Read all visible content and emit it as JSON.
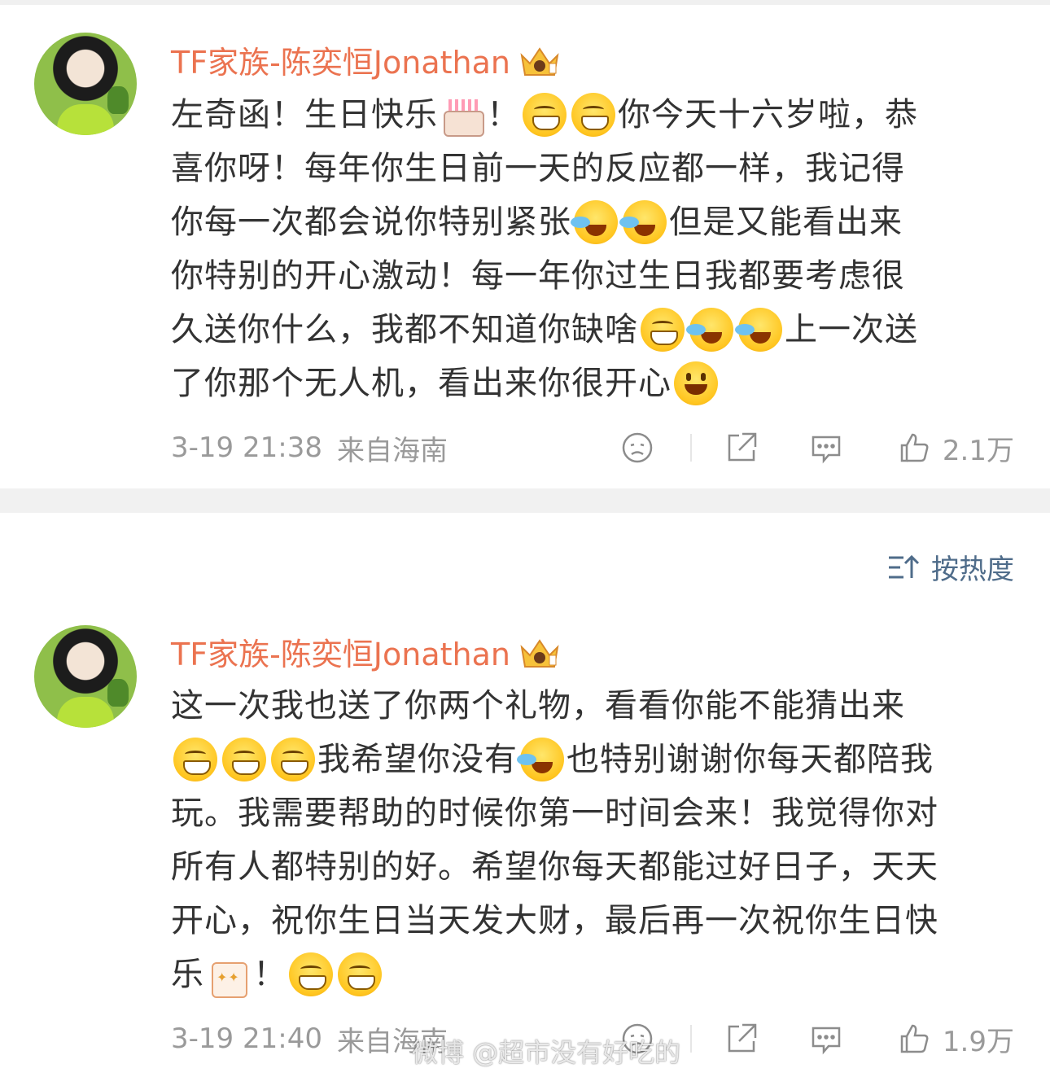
{
  "posts": [
    {
      "author": "TF家族-陈奕恒Jonathan",
      "badge_icon": "crown-badge-icon",
      "lines": [
        [
          "左奇函！生日快乐",
          {
            "e": "cake"
          },
          "！",
          {
            "e": "grin"
          },
          {
            "e": "grin"
          },
          "你今天十六岁啦，恭"
        ],
        [
          "喜你呀！每年你生日前一天的反应都一样，我记得"
        ],
        [
          "你每一次都会说你特别紧张",
          {
            "e": "cry"
          },
          {
            "e": "cry"
          },
          "但是又能看出来"
        ],
        [
          "你特别的开心激动！每一年你过生日我都要考虑很"
        ],
        [
          "久送你什么，我都不知道你缺啥",
          {
            "e": "grin"
          },
          {
            "e": "cry"
          },
          {
            "e": "cry"
          },
          "上一次送"
        ],
        [
          "了你那个无人机，看出来你很开心",
          {
            "e": "smile"
          }
        ]
      ],
      "time": "3-19 21:38",
      "source": "来自海南",
      "likes": "2.1万"
    },
    {
      "author": "TF家族-陈奕恒Jonathan",
      "badge_icon": "crown-badge-icon",
      "lines": [
        [
          "这一次我也送了你两个礼物，看看你能不能猜出来"
        ],
        [
          {
            "e": "grin"
          },
          {
            "e": "grin"
          },
          {
            "e": "grin"
          },
          "我希望你没有",
          {
            "e": "cry"
          },
          "也特别谢谢你每天都陪我"
        ],
        [
          "玩。我需要帮助的时候你第一时间会来！我觉得你对"
        ],
        [
          "所有人都特别的好。希望你每天都能过好日子，天天"
        ],
        [
          "开心，祝你生日当天发大财，最后再一次祝你生日快"
        ],
        [
          "乐",
          {
            "e": "party"
          },
          "！",
          {
            "e": "grin"
          },
          {
            "e": "grin"
          }
        ]
      ],
      "time": "3-19 21:40",
      "source": "来自海南",
      "likes": "1.9万"
    }
  ],
  "sort": {
    "label": "按热度"
  },
  "watermark": "微博 @超市没有好吃的",
  "colors": {
    "author": "#eb7350",
    "meta": "#9a9a9a",
    "sort": "#4f6c8a",
    "divider": "#f1f1f1"
  }
}
